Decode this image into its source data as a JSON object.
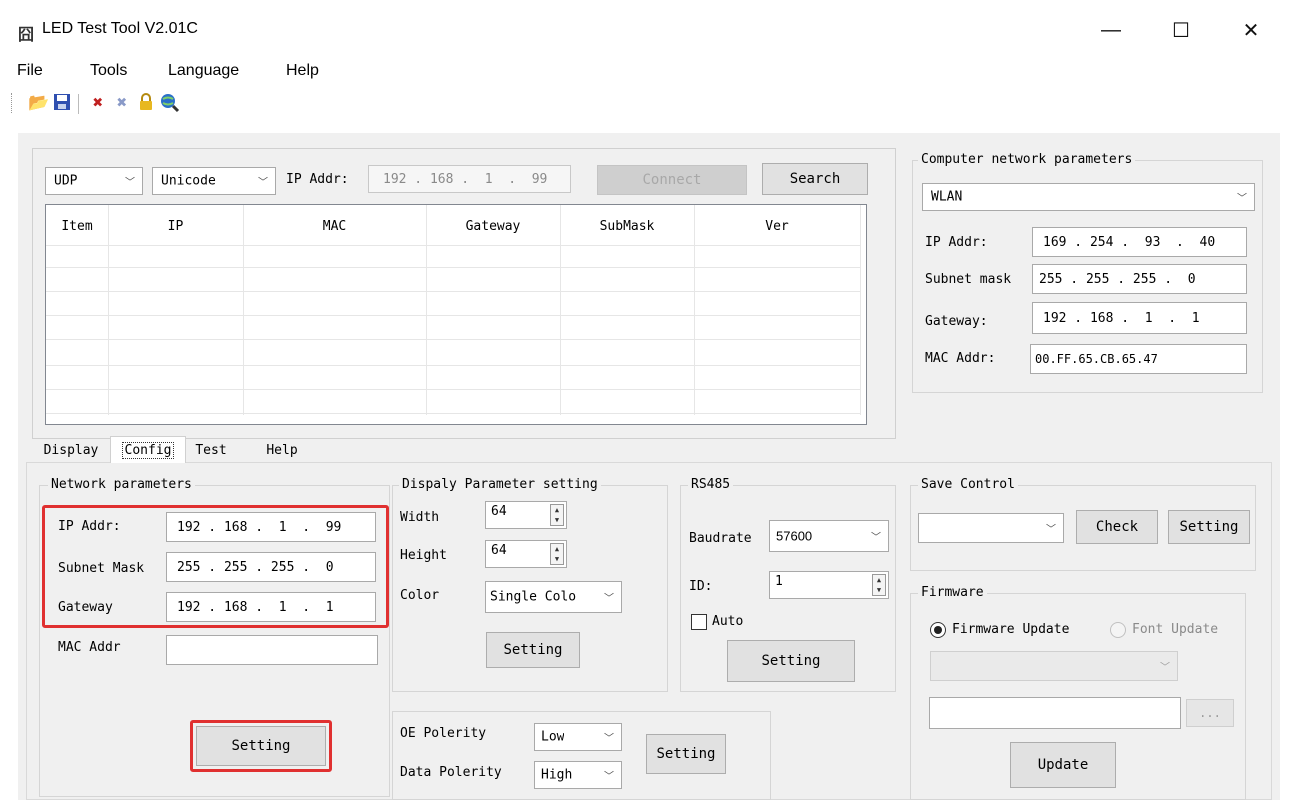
{
  "window": {
    "title": "LED Test Tool V2.01C",
    "minimize": "—",
    "maximize": "☐",
    "close": "✕"
  },
  "menu": [
    "File",
    "Tools",
    "Language",
    "Help"
  ],
  "toolbar_icons": [
    "open-folder-icon",
    "save-icon",
    "tools-icon",
    "disconnect-icon",
    "lock-icon",
    "globe-search-icon"
  ],
  "connection": {
    "protocol": "UDP",
    "encoding": "Unicode",
    "ip_label": "IP Addr:",
    "ip_value": "192 . 168 .  1  .  99",
    "connect_label": "Connect",
    "search_label": "Search"
  },
  "device_table": {
    "columns": [
      "Item",
      "IP",
      "MAC",
      "Gateway",
      "SubMask",
      "Ver"
    ],
    "rows": []
  },
  "computer_network": {
    "title": "Computer network parameters",
    "adapter": "WLAN",
    "ip_label": "IP Addr:",
    "ip_value": "169 . 254 .  93  .  40",
    "subnet_label": "Subnet mask",
    "subnet_value": "255 . 255 . 255 .  0",
    "gateway_label": "Gateway:",
    "gateway_value": "192 . 168 .  1  .  1",
    "mac_label": "MAC Addr:",
    "mac_value": "00.FF.65.CB.65.47"
  },
  "tabs": [
    "Display",
    "Config",
    "Test",
    "Help"
  ],
  "active_tab": "Config",
  "network_params": {
    "title": "Network parameters",
    "ip_label": "IP Addr:",
    "ip_value": "192 . 168 .  1  .  99",
    "subnet_label": "Subnet Mask",
    "subnet_value": "255 . 255 . 255 .  0",
    "gateway_label": "Gateway",
    "gateway_value": "192 . 168 .  1  .  1",
    "mac_label": "MAC Addr",
    "mac_value": "",
    "setting_label": "Setting"
  },
  "display_params": {
    "title": "Dispaly Parameter setting",
    "width_label": "Width",
    "width_value": "64",
    "height_label": "Height",
    "height_value": "64",
    "color_label": "Color",
    "color_value": "Single Colo",
    "setting_label": "Setting"
  },
  "polarity": {
    "oe_label": "OE Polerity",
    "oe_value": "Low",
    "data_label": "Data Polerity",
    "data_value": "High",
    "setting_label": "Setting"
  },
  "rs485": {
    "title": "RS485",
    "baud_label": "Baudrate",
    "baud_value": "57600",
    "id_label": "ID:",
    "id_value": "1",
    "auto_label": "Auto",
    "setting_label": "Setting"
  },
  "save_control": {
    "title": "Save Control",
    "selected": "",
    "check_label": "Check",
    "setting_label": "Setting"
  },
  "firmware": {
    "title": "Firmware",
    "firmware_update_label": "Firmware Update",
    "font_update_label": "Font Update",
    "file_path": "",
    "browse_label": "...",
    "update_label": "Update"
  },
  "colors": {
    "highlight": "#e03030",
    "panel_bg": "#f0f0f0",
    "button_bg": "#e1e1e1"
  }
}
